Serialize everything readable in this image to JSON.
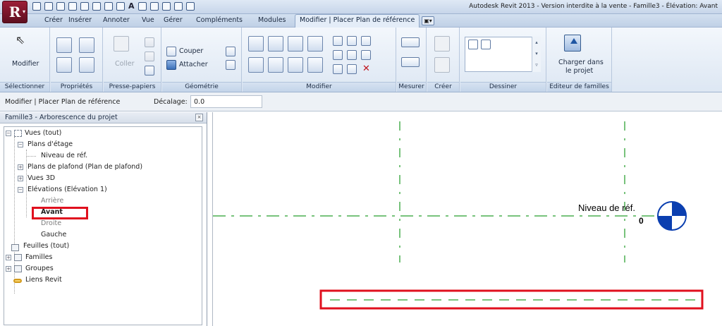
{
  "titlebar": {
    "app_title": "Autodesk Revit 2013 - Version interdite à la vente - Famille3 - Élévation: Avant",
    "logo_letter": "R"
  },
  "tabs": [
    {
      "label": "Créer",
      "active": false
    },
    {
      "label": "Insérer",
      "active": false
    },
    {
      "label": "Annoter",
      "active": false
    },
    {
      "label": "Vue",
      "active": false
    },
    {
      "label": "Gérer",
      "active": false
    },
    {
      "label": "Compléments",
      "active": false
    },
    {
      "label": "Modules",
      "active": false
    },
    {
      "label": "Modifier | Placer Plan de référence",
      "active": true
    }
  ],
  "ribbon": {
    "panels": {
      "selectionner": "Sélectionner",
      "proprietes": "Propriétés",
      "presse_papiers": "Presse-papiers",
      "geometrie": "Géométrie",
      "modifier": "Modifier",
      "mesurer": "Mesurer",
      "creer": "Créer",
      "dessiner": "Dessiner",
      "editeur": "Editeur de familles"
    },
    "modify_button": "Modifier",
    "paste_button": "Coller",
    "cut_button": "Couper",
    "join_button": "Attacher",
    "load_button_line1": "Charger dans",
    "load_button_line2": "le projet"
  },
  "optbar": {
    "context": "Modifier | Placer Plan de référence",
    "offset_label": "Décalage:",
    "offset_value": "0.0"
  },
  "browser": {
    "title": "Famille3 - Arborescence du projet",
    "items": {
      "views": "Vues (tout)",
      "floor_plans": "Plans d'étage",
      "ref_level": "Niveau de réf.",
      "ceiling_plans": "Plans de plafond (Plan de plafond)",
      "views3d": "Vues 3D",
      "elevations": "Elévations (Elévation 1)",
      "back": "Arrière",
      "front": "Avant",
      "right": "Droite",
      "left": "Gauche",
      "sheets": "Feuilles (tout)",
      "families": "Familles",
      "groups": "Groupes",
      "links": "Liens Revit"
    }
  },
  "canvas": {
    "level_name": "Niveau de réf.",
    "level_elevation": "0",
    "reference_line_color": "#4caf50",
    "highlight_color": "#e0101e",
    "level_marker_color": "#0b3fb0"
  }
}
